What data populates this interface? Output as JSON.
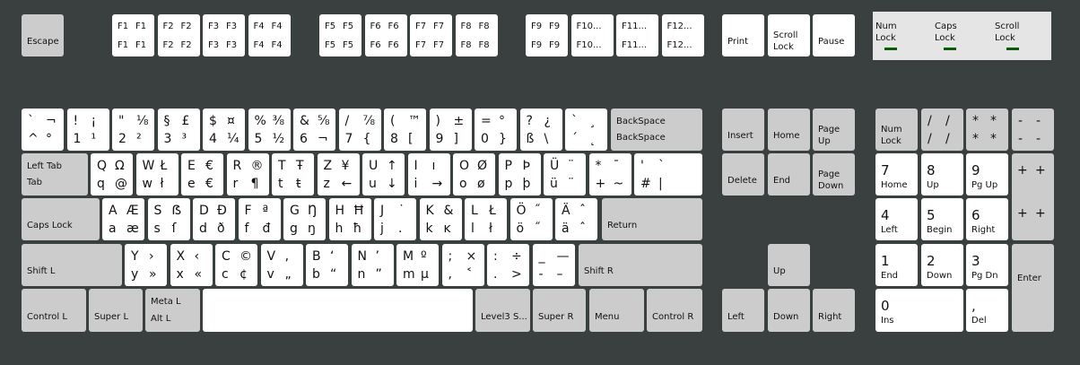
{
  "colors": {
    "key": "#ffffff",
    "modifier_key": "#cccccc",
    "background": "#3a3f3f",
    "led": "#0a5a0a",
    "indicator_panel": "#e5e5e5"
  },
  "indicators": [
    {
      "line1": "Num",
      "line2": "Lock"
    },
    {
      "line1": "Caps",
      "line2": "Lock"
    },
    {
      "line1": "Scroll",
      "line2": "Lock"
    }
  ],
  "keys": {
    "escape": {
      "lines": [
        "Escape"
      ]
    },
    "f1": {
      "legends": [
        "F1",
        "F1",
        "F1",
        "F1"
      ]
    },
    "f2": {
      "legends": [
        "F2",
        "F2",
        "F2",
        "F2"
      ]
    },
    "f3": {
      "legends": [
        "F3",
        "F3",
        "F3",
        "F3"
      ]
    },
    "f4": {
      "legends": [
        "F4",
        "F4",
        "F4",
        "F4"
      ]
    },
    "f5": {
      "legends": [
        "F5",
        "F5",
        "F5",
        "F5"
      ]
    },
    "f6": {
      "legends": [
        "F6",
        "F6",
        "F6",
        "F6"
      ]
    },
    "f7": {
      "legends": [
        "F7",
        "F7",
        "F7",
        "F7"
      ]
    },
    "f8": {
      "legends": [
        "F8",
        "F8",
        "F8",
        "F8"
      ]
    },
    "f9": {
      "legends": [
        "F9",
        "F9",
        "F9",
        "F9"
      ]
    },
    "f10": {
      "legends": [
        "F10...",
        "",
        "F10...",
        ""
      ]
    },
    "f11": {
      "legends": [
        "F11...",
        "",
        "F11...",
        ""
      ]
    },
    "f12": {
      "legends": [
        "F12...",
        "",
        "F12...",
        ""
      ]
    },
    "print": {
      "lines": [
        "Print"
      ]
    },
    "scroll-lock": {
      "lines": [
        "Scroll",
        "Lock"
      ]
    },
    "pause": {
      "lines": [
        "Pause"
      ]
    },
    "grave": {
      "legends": [
        "`",
        "¬",
        "^",
        "°"
      ]
    },
    "1": {
      "legends": [
        "!",
        "¡",
        "1",
        "¹"
      ]
    },
    "2": {
      "legends": [
        "\"",
        "⅛",
        "2",
        "²"
      ]
    },
    "3": {
      "legends": [
        "§",
        "£",
        "3",
        "³"
      ]
    },
    "4": {
      "legends": [
        "$",
        "¤",
        "4",
        "¼"
      ]
    },
    "5": {
      "legends": [
        "%",
        "⅜",
        "5",
        "½"
      ]
    },
    "6": {
      "legends": [
        "&",
        "⅝",
        "6",
        "¬"
      ]
    },
    "7": {
      "legends": [
        "/",
        "⅞",
        "7",
        "{"
      ]
    },
    "8": {
      "legends": [
        "(",
        "™",
        "8",
        "["
      ]
    },
    "9": {
      "legends": [
        ")",
        "±",
        "9",
        "]"
      ]
    },
    "0": {
      "legends": [
        "=",
        "°",
        "0",
        "}"
      ]
    },
    "sz": {
      "legends": [
        "?",
        "¿",
        "ß",
        "\\"
      ]
    },
    "acute": {
      "legends": [
        "`",
        "¸",
        "´",
        "˛"
      ]
    },
    "backspace": {
      "lines": [
        "BackSpace",
        "BackSpace"
      ]
    },
    "tab": {
      "lines": [
        "Left Tab",
        "Tab"
      ]
    },
    "q": {
      "legends": [
        "Q",
        "Ω",
        "q",
        "@"
      ]
    },
    "w": {
      "legends": [
        "W",
        "Ł",
        "w",
        "ł"
      ]
    },
    "e": {
      "legends": [
        "E",
        "€",
        "e",
        "€"
      ]
    },
    "r": {
      "legends": [
        "R",
        "®",
        "r",
        "¶"
      ]
    },
    "t": {
      "legends": [
        "T",
        "Ŧ",
        "t",
        "ŧ"
      ]
    },
    "z": {
      "legends": [
        "Z",
        "¥",
        "z",
        "←"
      ]
    },
    "u": {
      "legends": [
        "U",
        "↑",
        "u",
        "↓"
      ]
    },
    "i": {
      "legends": [
        "I",
        "ı",
        "i",
        "→"
      ]
    },
    "o": {
      "legends": [
        "O",
        "Ø",
        "o",
        "ø"
      ]
    },
    "p": {
      "legends": [
        "P",
        "Þ",
        "p",
        "þ"
      ]
    },
    "ue": {
      "legends": [
        "Ü",
        "¨",
        "ü",
        "¨"
      ]
    },
    "plus": {
      "legends": [
        "*",
        "¯",
        "+",
        "~"
      ]
    },
    "hash": {
      "legends": [
        "'",
        "`",
        "#",
        "|"
      ]
    },
    "caps-lock": {
      "lines": [
        "Caps Lock"
      ]
    },
    "a": {
      "legends": [
        "A",
        "Æ",
        "a",
        "æ"
      ]
    },
    "s": {
      "legends": [
        "S",
        "ẞ",
        "s",
        "ſ"
      ]
    },
    "d": {
      "legends": [
        "D",
        "Ð",
        "d",
        "ð"
      ]
    },
    "f": {
      "legends": [
        "F",
        "ª",
        "f",
        "đ"
      ]
    },
    "g": {
      "legends": [
        "G",
        "Ŋ",
        "g",
        "ŋ"
      ]
    },
    "h": {
      "legends": [
        "H",
        "Ħ",
        "h",
        "ħ"
      ]
    },
    "j": {
      "legends": [
        "J",
        "˙",
        "j",
        "."
      ]
    },
    "k": {
      "legends": [
        "K",
        "&",
        "k",
        "ĸ"
      ]
    },
    "l": {
      "legends": [
        "L",
        "Ł",
        "l",
        "ł"
      ]
    },
    "oe": {
      "legends": [
        "Ö",
        "˝",
        "ö",
        "˝"
      ]
    },
    "ae": {
      "legends": [
        "Ä",
        "ˆ",
        "ä",
        "ˆ"
      ]
    },
    "return": {
      "lines": [
        "Return"
      ]
    },
    "shift-l": {
      "lines": [
        "Shift L"
      ]
    },
    "y": {
      "legends": [
        "Y",
        "›",
        "y",
        "»"
      ]
    },
    "x": {
      "legends": [
        "X",
        "‹",
        "x",
        "«"
      ]
    },
    "c": {
      "legends": [
        "C",
        "©",
        "c",
        "¢"
      ]
    },
    "v": {
      "legends": [
        "V",
        "‚",
        "v",
        "„"
      ]
    },
    "b": {
      "legends": [
        "B",
        "‘",
        "b",
        "“"
      ]
    },
    "n": {
      "legends": [
        "N",
        "’",
        "n",
        "”"
      ]
    },
    "m": {
      "legends": [
        "M",
        "º",
        "m",
        "µ"
      ]
    },
    "comma": {
      "legends": [
        ";",
        "×",
        ",",
        "˂"
      ]
    },
    "period": {
      "legends": [
        ":",
        "÷",
        ".",
        ">"
      ]
    },
    "minus": {
      "legends": [
        "_",
        "—",
        "-",
        "–"
      ]
    },
    "shift-r": {
      "lines": [
        "Shift R"
      ]
    },
    "control-l": {
      "lines": [
        "Control L"
      ]
    },
    "super-l": {
      "lines": [
        "Super L"
      ]
    },
    "alt-l": {
      "lines": [
        "Meta L",
        "Alt L"
      ]
    },
    "space": {
      "lines": [
        ""
      ]
    },
    "level3": {
      "lines": [
        "Level3 S..."
      ]
    },
    "super-r": {
      "lines": [
        "Super R"
      ]
    },
    "menu": {
      "lines": [
        "Menu"
      ]
    },
    "control-r": {
      "lines": [
        "Control R"
      ]
    },
    "insert": {
      "lines": [
        "Insert"
      ]
    },
    "home": {
      "lines": [
        "Home"
      ]
    },
    "page-up": {
      "lines": [
        "Page",
        "Up"
      ]
    },
    "delete": {
      "lines": [
        "Delete"
      ]
    },
    "end": {
      "lines": [
        "End"
      ]
    },
    "page-down": {
      "lines": [
        "Page",
        "Down"
      ]
    },
    "up": {
      "lines": [
        "Up"
      ]
    },
    "left": {
      "lines": [
        "Left"
      ]
    },
    "down": {
      "lines": [
        "Down"
      ]
    },
    "right": {
      "lines": [
        "Right"
      ]
    },
    "num-lock": {
      "lines": [
        "Num",
        "Lock"
      ]
    },
    "kp-divide": {
      "legends": [
        "/",
        "/",
        "/",
        "/"
      ]
    },
    "kp-multiply": {
      "legends": [
        "*",
        "*",
        "*",
        "*"
      ]
    },
    "kp-subtract": {
      "legends": [
        "-",
        "-",
        "-",
        "-"
      ]
    },
    "kp-7": {
      "num": [
        "7",
        "Home"
      ]
    },
    "kp-8": {
      "num": [
        "8",
        "Up"
      ]
    },
    "kp-9": {
      "num": [
        "9",
        "Pg Up"
      ]
    },
    "kp-add": {
      "legends": [
        "+",
        "+",
        "+",
        "+"
      ]
    },
    "kp-4": {
      "num": [
        "4",
        "Left"
      ]
    },
    "kp-5": {
      "num": [
        "5",
        "Begin"
      ]
    },
    "kp-6": {
      "num": [
        "6",
        "Right"
      ]
    },
    "kp-1": {
      "num": [
        "1",
        "End"
      ]
    },
    "kp-2": {
      "num": [
        "2",
        "Down"
      ]
    },
    "kp-3": {
      "num": [
        "3",
        "Pg Dn"
      ]
    },
    "kp-enter": {
      "lines": [
        "Enter"
      ]
    },
    "kp-0": {
      "num": [
        "0",
        "Ins"
      ]
    },
    "kp-decimal": {
      "num": [
        ",",
        "Del"
      ]
    }
  }
}
